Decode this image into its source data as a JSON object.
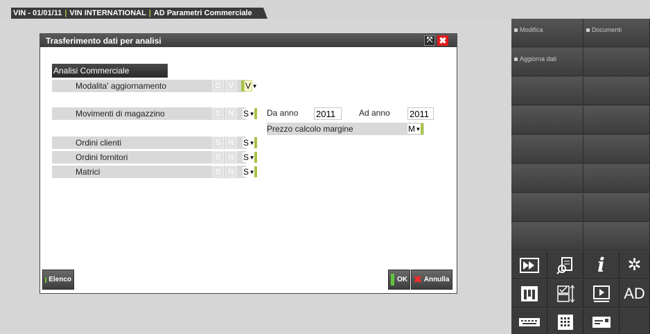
{
  "tabs": [
    "VIN - 01/01/11",
    "VIN INTERNATIONAL",
    "AD Parametri Commerciale"
  ],
  "dialog": {
    "title": "Trasferimento dati per analisi",
    "section": "Analisi Commerciale",
    "rows": [
      {
        "label": "Modalita' aggiornamento",
        "opt1": "C",
        "opt2": "V",
        "value": "V"
      },
      {
        "label": "Movimenti di magazzino",
        "opt1": "S",
        "opt2": "N",
        "value": "S"
      },
      {
        "label": "Ordini clienti",
        "opt1": "S",
        "opt2": "N",
        "value": "S"
      },
      {
        "label": "Ordini fornitori",
        "opt1": "S",
        "opt2": "N",
        "value": "S"
      },
      {
        "label": "Matrici",
        "opt1": "S",
        "opt2": "N",
        "value": "S"
      }
    ],
    "da_anno_label": "Da anno",
    "da_anno_value": "2011",
    "ad_anno_label": "Ad anno",
    "ad_anno_value": "2011",
    "prezzo_label": "Prezzo calcolo margine",
    "prezzo_value": "M",
    "elenco_label": "Elenco",
    "ok_label": "OK",
    "annulla_label": "Annulla"
  },
  "right_panel": {
    "buttons": [
      "Modifica",
      "Documenti",
      "Aggiorna dati"
    ],
    "ad_label": "AD"
  }
}
